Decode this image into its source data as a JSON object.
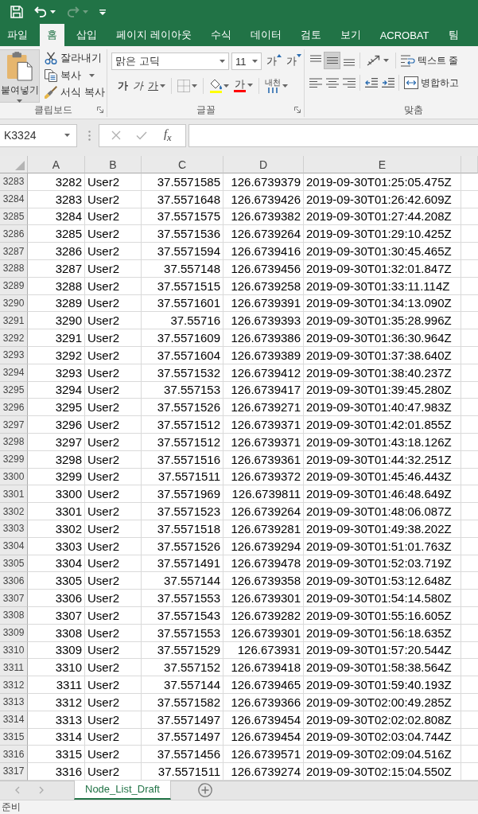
{
  "quick_access": [
    {
      "kind": "save",
      "disabled": false,
      "menu": false
    },
    {
      "kind": "undo",
      "disabled": false,
      "menu": true
    },
    {
      "kind": "redo",
      "disabled": true,
      "menu": true
    },
    {
      "kind": "customize",
      "disabled": false,
      "menu": false
    }
  ],
  "tabs": [
    {
      "label": "파일",
      "selected": false
    },
    {
      "label": "홈",
      "selected": true
    },
    {
      "label": "삽입",
      "selected": false
    },
    {
      "label": "페이지 레이아웃",
      "selected": false
    },
    {
      "label": "수식",
      "selected": false
    },
    {
      "label": "데이터",
      "selected": false
    },
    {
      "label": "검토",
      "selected": false
    },
    {
      "label": "보기",
      "selected": false
    },
    {
      "label": "ACROBAT",
      "selected": false
    },
    {
      "label": "팀",
      "selected": false
    }
  ],
  "ribbon": {
    "clipboard": {
      "label": "클립보드",
      "paste": {
        "label": "붙여넣기",
        "menu": true
      },
      "commands": [
        {
          "kind": "cut",
          "label": "잘라내기",
          "menu": false
        },
        {
          "kind": "copy",
          "label": "복사",
          "menu": true
        },
        {
          "kind": "format_painter",
          "label": "서식 복사",
          "menu": false
        }
      ]
    },
    "font": {
      "label": "글꼴",
      "font_name": "맑은 고딕",
      "font_size": "11",
      "size_buttons": [
        {
          "kind": "grow",
          "label": "가"
        },
        {
          "kind": "shrink",
          "label": "가"
        }
      ],
      "format_buttons": [
        {
          "kind": "bold",
          "label": "가",
          "menu": false
        },
        {
          "kind": "italic",
          "label": "가",
          "menu": false
        },
        {
          "kind": "underline",
          "label": "가",
          "menu": true
        },
        {
          "kind": "borders",
          "menu": true
        },
        {
          "kind": "fill_color",
          "color": "#ffff00",
          "menu": true
        },
        {
          "kind": "font_color",
          "label": "가",
          "color": "#ff0000",
          "menu": true
        },
        {
          "kind": "phonetic_guide",
          "label": "내천",
          "menu": true
        }
      ]
    },
    "alignment": {
      "label": "맞춤",
      "vertical_align": [
        {
          "kind": "top",
          "selected": false
        },
        {
          "kind": "middle",
          "selected": true
        },
        {
          "kind": "bottom",
          "selected": false
        }
      ],
      "orientation": {
        "menu": true
      },
      "wrap_text": "텍스트 줄",
      "horizontal_align": [
        {
          "kind": "left",
          "selected": false
        },
        {
          "kind": "center",
          "selected": false
        },
        {
          "kind": "right",
          "selected": false
        }
      ],
      "indent": [
        {
          "kind": "decrease"
        },
        {
          "kind": "increase"
        }
      ],
      "merge": "병합하고"
    }
  },
  "formula_bar": {
    "name_box": "K3324",
    "editing": false,
    "insert_function": "f$_{x}$"
  },
  "sheet": {
    "columns": [
      {
        "label": "A",
        "kind": "number"
      },
      {
        "label": "B",
        "kind": "text"
      },
      {
        "label": "C",
        "kind": "number"
      },
      {
        "label": "D",
        "kind": "number"
      },
      {
        "label": "E",
        "kind": "text"
      }
    ],
    "rows": [
      {
        "number": "3283",
        "cells": [
          "3282",
          "User2",
          "37.5571585",
          "126.6739379",
          "2019-09-30T01:25:05.475Z"
        ]
      },
      {
        "number": "3284",
        "cells": [
          "3283",
          "User2",
          "37.5571648",
          "126.6739426",
          "2019-09-30T01:26:42.609Z"
        ]
      },
      {
        "number": "3285",
        "cells": [
          "3284",
          "User2",
          "37.5571575",
          "126.6739382",
          "2019-09-30T01:27:44.208Z"
        ]
      },
      {
        "number": "3286",
        "cells": [
          "3285",
          "User2",
          "37.5571536",
          "126.6739264",
          "2019-09-30T01:29:10.425Z"
        ]
      },
      {
        "number": "3287",
        "cells": [
          "3286",
          "User2",
          "37.5571594",
          "126.6739416",
          "2019-09-30T01:30:45.465Z"
        ]
      },
      {
        "number": "3288",
        "cells": [
          "3287",
          "User2",
          "37.557148",
          "126.6739456",
          "2019-09-30T01:32:01.847Z"
        ]
      },
      {
        "number": "3289",
        "cells": [
          "3288",
          "User2",
          "37.5571515",
          "126.6739258",
          "2019-09-30T01:33:11.114Z"
        ]
      },
      {
        "number": "3290",
        "cells": [
          "3289",
          "User2",
          "37.5571601",
          "126.6739391",
          "2019-09-30T01:34:13.090Z"
        ]
      },
      {
        "number": "3291",
        "cells": [
          "3290",
          "User2",
          "37.55716",
          "126.6739393",
          "2019-09-30T01:35:28.996Z"
        ]
      },
      {
        "number": "3292",
        "cells": [
          "3291",
          "User2",
          "37.5571609",
          "126.6739386",
          "2019-09-30T01:36:30.964Z"
        ]
      },
      {
        "number": "3293",
        "cells": [
          "3292",
          "User2",
          "37.5571604",
          "126.6739389",
          "2019-09-30T01:37:38.640Z"
        ]
      },
      {
        "number": "3294",
        "cells": [
          "3293",
          "User2",
          "37.5571532",
          "126.6739412",
          "2019-09-30T01:38:40.237Z"
        ]
      },
      {
        "number": "3295",
        "cells": [
          "3294",
          "User2",
          "37.557153",
          "126.6739417",
          "2019-09-30T01:39:45.280Z"
        ]
      },
      {
        "number": "3296",
        "cells": [
          "3295",
          "User2",
          "37.5571526",
          "126.6739271",
          "2019-09-30T01:40:47.983Z"
        ]
      },
      {
        "number": "3297",
        "cells": [
          "3296",
          "User2",
          "37.5571512",
          "126.6739371",
          "2019-09-30T01:42:01.855Z"
        ]
      },
      {
        "number": "3298",
        "cells": [
          "3297",
          "User2",
          "37.5571512",
          "126.6739371",
          "2019-09-30T01:43:18.126Z"
        ]
      },
      {
        "number": "3299",
        "cells": [
          "3298",
          "User2",
          "37.5571516",
          "126.6739361",
          "2019-09-30T01:44:32.251Z"
        ]
      },
      {
        "number": "3300",
        "cells": [
          "3299",
          "User2",
          "37.5571511",
          "126.6739372",
          "2019-09-30T01:45:46.443Z"
        ]
      },
      {
        "number": "3301",
        "cells": [
          "3300",
          "User2",
          "37.5571969",
          "126.6739811",
          "2019-09-30T01:46:48.649Z"
        ]
      },
      {
        "number": "3302",
        "cells": [
          "3301",
          "User2",
          "37.5571523",
          "126.6739264",
          "2019-09-30T01:48:06.087Z"
        ]
      },
      {
        "number": "3303",
        "cells": [
          "3302",
          "User2",
          "37.5571518",
          "126.6739281",
          "2019-09-30T01:49:38.202Z"
        ]
      },
      {
        "number": "3304",
        "cells": [
          "3303",
          "User2",
          "37.5571526",
          "126.6739294",
          "2019-09-30T01:51:01.763Z"
        ]
      },
      {
        "number": "3305",
        "cells": [
          "3304",
          "User2",
          "37.5571491",
          "126.6739478",
          "2019-09-30T01:52:03.719Z"
        ]
      },
      {
        "number": "3306",
        "cells": [
          "3305",
          "User2",
          "37.557144",
          "126.6739358",
          "2019-09-30T01:53:12.648Z"
        ]
      },
      {
        "number": "3307",
        "cells": [
          "3306",
          "User2",
          "37.5571553",
          "126.6739301",
          "2019-09-30T01:54:14.580Z"
        ]
      },
      {
        "number": "3308",
        "cells": [
          "3307",
          "User2",
          "37.5571543",
          "126.6739282",
          "2019-09-30T01:55:16.605Z"
        ]
      },
      {
        "number": "3309",
        "cells": [
          "3308",
          "User2",
          "37.5571553",
          "126.6739301",
          "2019-09-30T01:56:18.635Z"
        ]
      },
      {
        "number": "3310",
        "cells": [
          "3309",
          "User2",
          "37.5571529",
          "126.673931",
          "2019-09-30T01:57:20.544Z"
        ]
      },
      {
        "number": "3311",
        "cells": [
          "3310",
          "User2",
          "37.557152",
          "126.6739418",
          "2019-09-30T01:58:38.564Z"
        ]
      },
      {
        "number": "3312",
        "cells": [
          "3311",
          "User2",
          "37.557144",
          "126.6739465",
          "2019-09-30T01:59:40.193Z"
        ]
      },
      {
        "number": "3313",
        "cells": [
          "3312",
          "User2",
          "37.5571582",
          "126.6739366",
          "2019-09-30T02:00:49.285Z"
        ]
      },
      {
        "number": "3314",
        "cells": [
          "3313",
          "User2",
          "37.5571497",
          "126.6739454",
          "2019-09-30T02:02:02.808Z"
        ]
      },
      {
        "number": "3315",
        "cells": [
          "3314",
          "User2",
          "37.5571497",
          "126.6739454",
          "2019-09-30T02:03:04.744Z"
        ]
      },
      {
        "number": "3316",
        "cells": [
          "3315",
          "User2",
          "37.5571456",
          "126.6739571",
          "2019-09-30T02:09:04.516Z"
        ]
      },
      {
        "number": "3317",
        "cells": [
          "3316",
          "User2",
          "37.5571511",
          "126.6739274",
          "2019-09-30T02:15:04.550Z"
        ]
      }
    ]
  },
  "sheet_tabs": [
    {
      "label": "Node_List_Draft",
      "selected": true
    }
  ],
  "status_bar": {
    "text": "준비"
  }
}
